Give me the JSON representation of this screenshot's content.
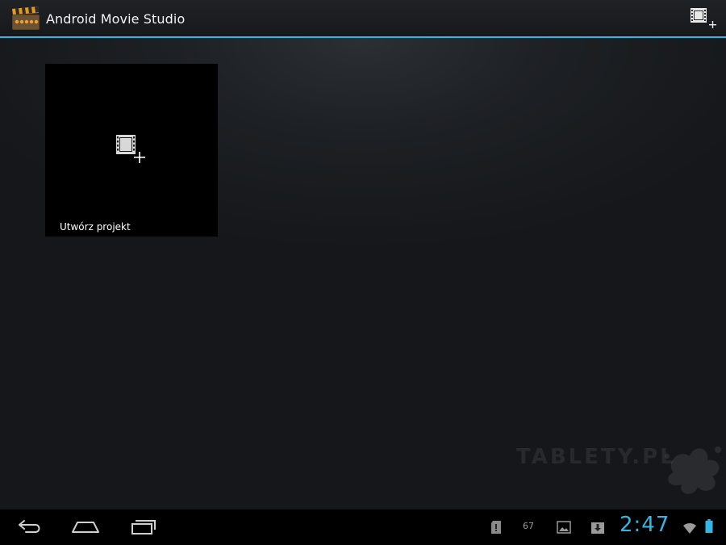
{
  "app": {
    "title": "Android Movie Studio",
    "icon": "clapperboard-icon",
    "accent_color": "#33b5e5"
  },
  "action_bar": {
    "new_project_icon": "film-plus-icon"
  },
  "projects": [
    {
      "label": "Utwórz projekt",
      "icon": "film-plus-icon"
    }
  ],
  "watermark": {
    "text": "TABLETY.PL"
  },
  "system_bar": {
    "nav": [
      "back-icon",
      "home-icon",
      "recent-apps-icon"
    ],
    "notification_count": "67",
    "clock": "2:47",
    "status_icons": [
      "sd-card-icon",
      "image-icon",
      "download-icon",
      "wifi-icon",
      "battery-icon"
    ]
  }
}
